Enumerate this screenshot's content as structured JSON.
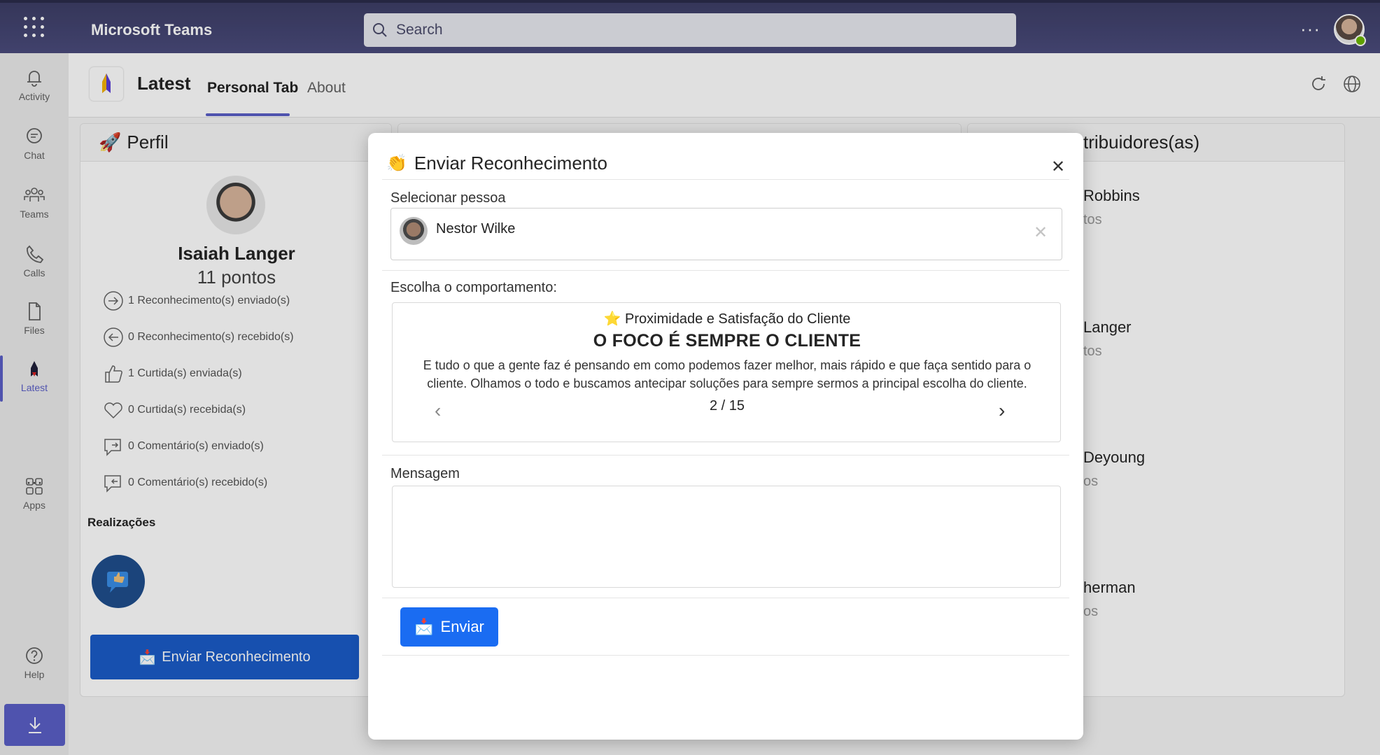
{
  "topbar": {
    "app_title": "Microsoft Teams",
    "search_placeholder": "Search",
    "more_label": "···"
  },
  "rail": {
    "items": [
      {
        "label": "Activity",
        "icon": "bell-icon"
      },
      {
        "label": "Chat",
        "icon": "chat-icon"
      },
      {
        "label": "Teams",
        "icon": "teams-icon"
      },
      {
        "label": "Calls",
        "icon": "phone-icon"
      },
      {
        "label": "Files",
        "icon": "file-icon"
      },
      {
        "label": "Latest",
        "icon": "latest-app-icon"
      },
      {
        "label": "Apps",
        "icon": "apps-icon"
      },
      {
        "label": "Help",
        "icon": "help-icon"
      }
    ],
    "more_label": "···",
    "active_color": "#5b5fc7"
  },
  "app_header": {
    "app_name": "Latest",
    "tabs": [
      {
        "label": "Personal Tab",
        "active": true
      },
      {
        "label": "About",
        "active": false
      }
    ]
  },
  "profile": {
    "card_title": "Perfil",
    "name": "Isaiah Langer",
    "points": "11 pontos",
    "stats": [
      "1 Reconhecimento(s) enviado(s)",
      "0 Reconhecimento(s) recebido(s)",
      "1 Curtida(s) enviada(s)",
      "0 Curtida(s) recebida(s)",
      "0 Comentário(s) enviado(s)",
      "0 Comentário(s) recebido(s)"
    ],
    "achievements_label": "Realizações",
    "send_button": "Enviar Reconhecimento"
  },
  "contributors": {
    "card_title_partial": "tribuidores(as)",
    "entries": [
      {
        "name": "Robbins",
        "pts": "tos"
      },
      {
        "name": "Langer",
        "pts": "tos"
      },
      {
        "name": "Deyoung",
        "pts": "os"
      },
      {
        "name": "herman",
        "pts": "os"
      }
    ]
  },
  "modal": {
    "title": "Enviar Reconhecimento",
    "title_emoji": "👏",
    "close_label": "✕",
    "select_person_label": "Selecionar pessoa",
    "selected_person": "Nestor Wilke",
    "clear_label": "✕",
    "behavior_label": "Escolha o comportamento:",
    "behavior": {
      "category": "Proximidade e Satisfação do Cliente",
      "category_emoji": "⭐",
      "title": "O FOCO É SEMPRE O CLIENTE",
      "description": "E tudo o que a gente faz é pensando em como podemos fazer melhor, mais rápido e que faça sentido para o cliente. Olhamos o todo e buscamos antecipar soluções para sempre sermos a principal escolha do cliente.",
      "page": "2 / 15",
      "prev": "‹",
      "next": "›"
    },
    "message_label": "Mensagem",
    "message_value": "",
    "send_button": "Enviar",
    "send_color": "#1a6cf2"
  }
}
